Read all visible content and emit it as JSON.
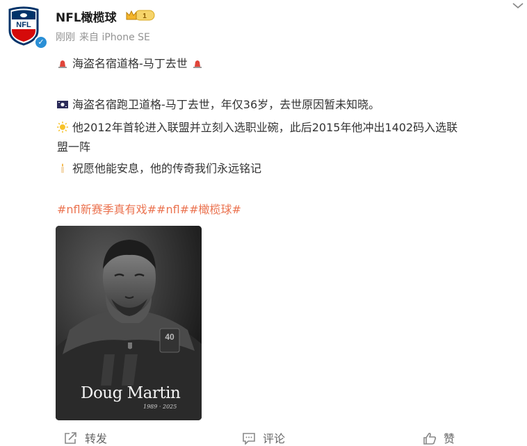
{
  "author": {
    "name": "NFL橄榄球",
    "badge_level": "1",
    "time": "刚刚",
    "source": "来自 iPhone SE"
  },
  "post": {
    "line1": "海盗名宿道格-马丁去世",
    "line2": "海盗名宿跑卫道格-马丁去世，年仅36岁，去世原因暂未知晓。",
    "line3": "他2012年首轮进入联盟并立刻入选职业碗，此后2015年他冲出1402码入选联",
    "line3b": "盟一阵",
    "line4": "祝愿他能安息，他的传奇我们永远铭记",
    "tags": "#nfl新赛季真有戏##nfl##橄榄球#"
  },
  "photo": {
    "name": "Doug Martin",
    "dates": "1989 · 2025"
  },
  "actions": {
    "repost": "转发",
    "comment": "评论",
    "like": "赞"
  },
  "colors": {
    "link": "#eb7350",
    "verified": "#2a8fd6",
    "meta": "#939393"
  }
}
